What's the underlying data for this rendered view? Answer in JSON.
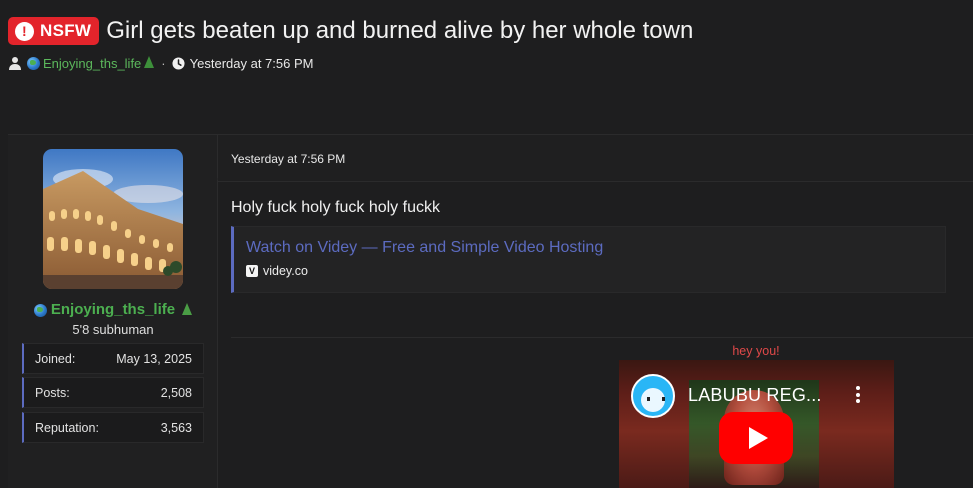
{
  "thread": {
    "badge": "NSFW",
    "title": "Girl gets beaten up and burned alive by her whole town",
    "author": "Enjoying_ths_life",
    "timestamp": "Yesterday at 7:56 PM"
  },
  "post": {
    "author": {
      "username": "Enjoying_ths_life",
      "user_title": "5'8 subhuman",
      "stats": [
        {
          "label": "Joined:",
          "value": "May 13, 2025"
        },
        {
          "label": "Posts:",
          "value": "2,508"
        },
        {
          "label": "Reputation:",
          "value": "3,563"
        }
      ]
    },
    "date": "Yesterday at 7:56 PM",
    "body": "Holy fuck holy fuck holy fuckk",
    "embed": {
      "title": "Watch on Videy — Free and Simple Video Hosting",
      "favicon_letter": "V",
      "site": "videy.co"
    },
    "signature": {
      "text": "hey you!",
      "video_title": "LABUBU REG..."
    }
  },
  "colors": {
    "background": "#1e1e1f",
    "nsfw_red": "#e3242b",
    "username_green": "#4caf50",
    "link_blue": "#5c6bc0",
    "signature_red": "#e04949",
    "youtube_red": "#ff0000"
  },
  "icons": [
    "alert-icon",
    "user-icon",
    "globe-emoji-icon",
    "tree-emoji-icon",
    "clock-icon",
    "videy-favicon-icon",
    "play-icon",
    "kebab-menu-icon"
  ]
}
